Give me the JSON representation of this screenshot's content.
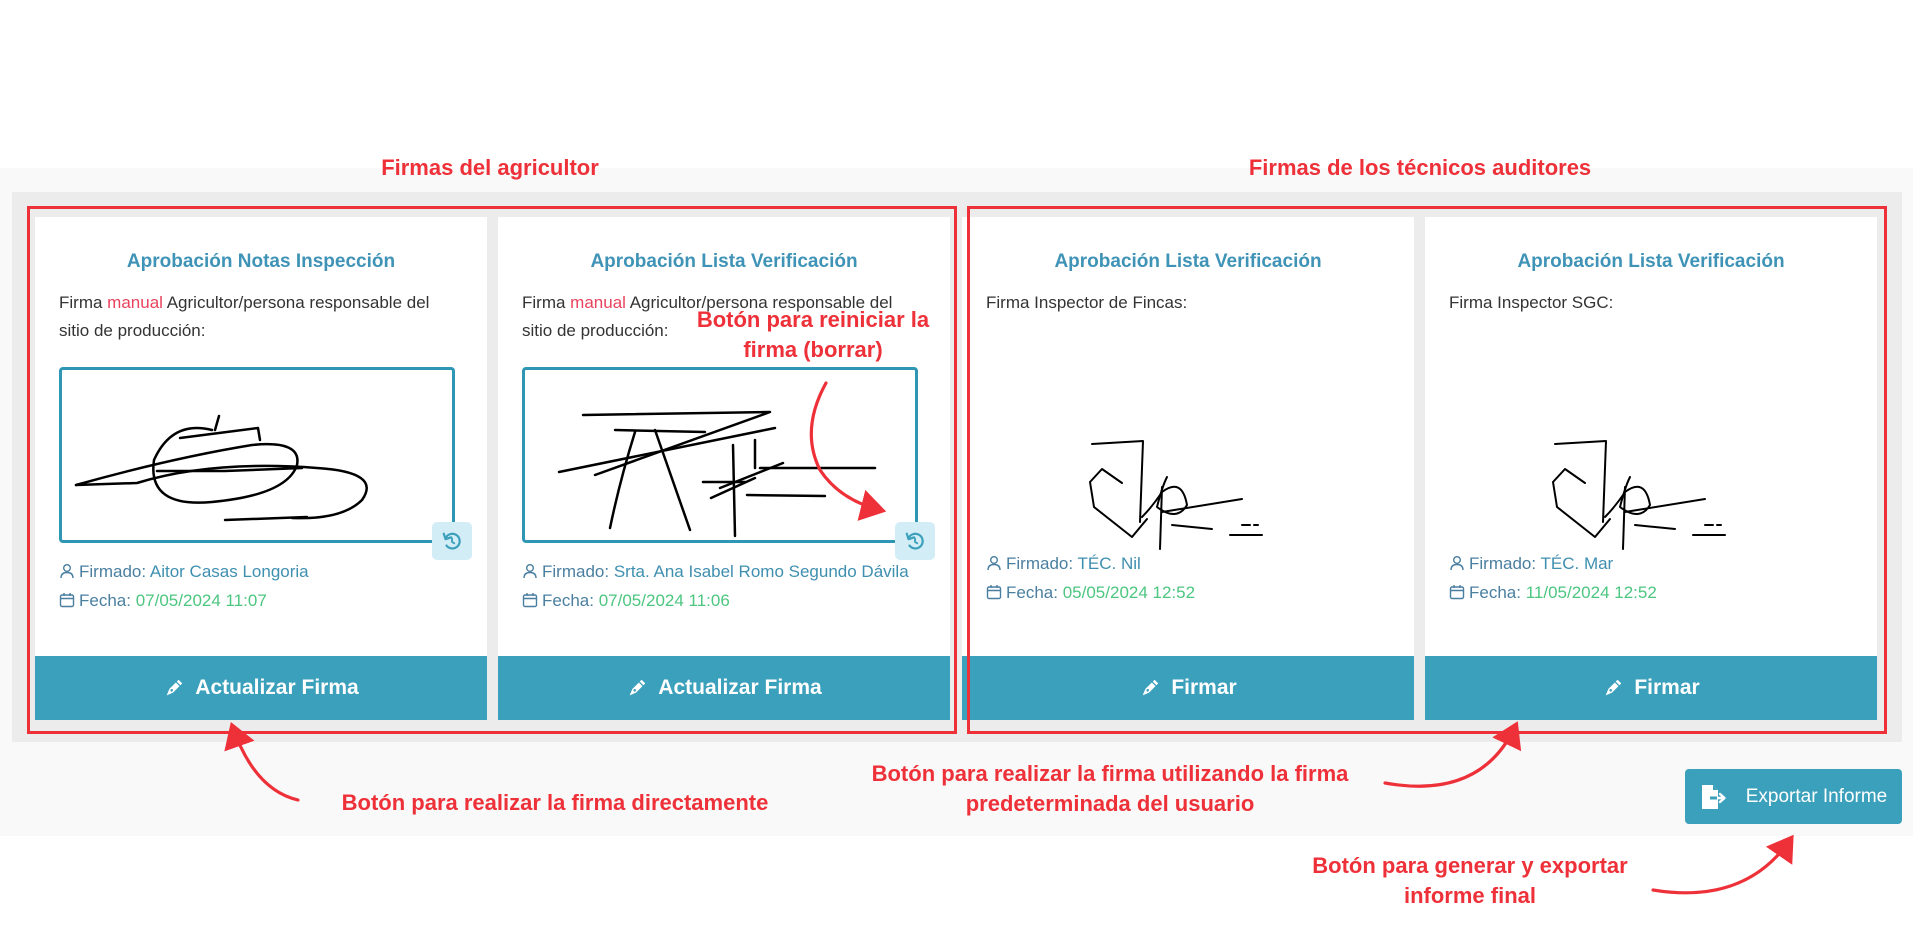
{
  "annotations": {
    "farmer_header": "Firmas del agricultor",
    "tech_header": "Firmas de los técnicos auditores",
    "reset_note": "Botón para reiniciar la firma (borrar)",
    "direct_sign_note": "Botón para realizar la firma directamente",
    "default_sign_note": "Botón para realizar la firma utilizando la firma predeterminada del usuario",
    "export_note": "Botón para generar y exportar informe final"
  },
  "cards": [
    {
      "title": "Aprobación Notas Inspección",
      "desc_prefix": "Firma ",
      "desc_manual": "manual",
      "desc_suffix": " Agricultor/persona responsable del sitio de producción:",
      "signed_label": "Firmado:",
      "signed_by": "Aitor Casas Longoria",
      "date_label": "Fecha:",
      "date": "07/05/2024 11:07",
      "button": "Actualizar Firma"
    },
    {
      "title": "Aprobación Lista Verificación",
      "desc_prefix": "Firma ",
      "desc_manual": "manual",
      "desc_suffix": " Agricultor/persona responsable del sitio de producción:",
      "signed_label": "Firmado:",
      "signed_by": "Srta. Ana Isabel Romo Segundo Dávila",
      "date_label": "Fecha:",
      "date": "07/05/2024 11:06",
      "button": "Actualizar Firma"
    },
    {
      "title": "Aprobación Lista Verificación",
      "desc": "Firma Inspector de Fincas:",
      "signed_label": "Firmado:",
      "signed_by": "TÉC. Nil",
      "date_label": "Fecha:",
      "date": "05/05/2024 12:52",
      "button": "Firmar"
    },
    {
      "title": "Aprobación Lista Verificación",
      "desc": "Firma Inspector SGC:",
      "signed_label": "Firmado:",
      "signed_by": "TÉC. Mar",
      "date_label": "Fecha:",
      "date": "11/05/2024 12:52",
      "button": "Firmar"
    }
  ],
  "export_button": "Exportar Informe",
  "colors": {
    "accent": "#3ba0bb",
    "title": "#3f93b6",
    "manual": "#e8435d",
    "date": "#4cc680",
    "annotation": "#ee3039"
  }
}
